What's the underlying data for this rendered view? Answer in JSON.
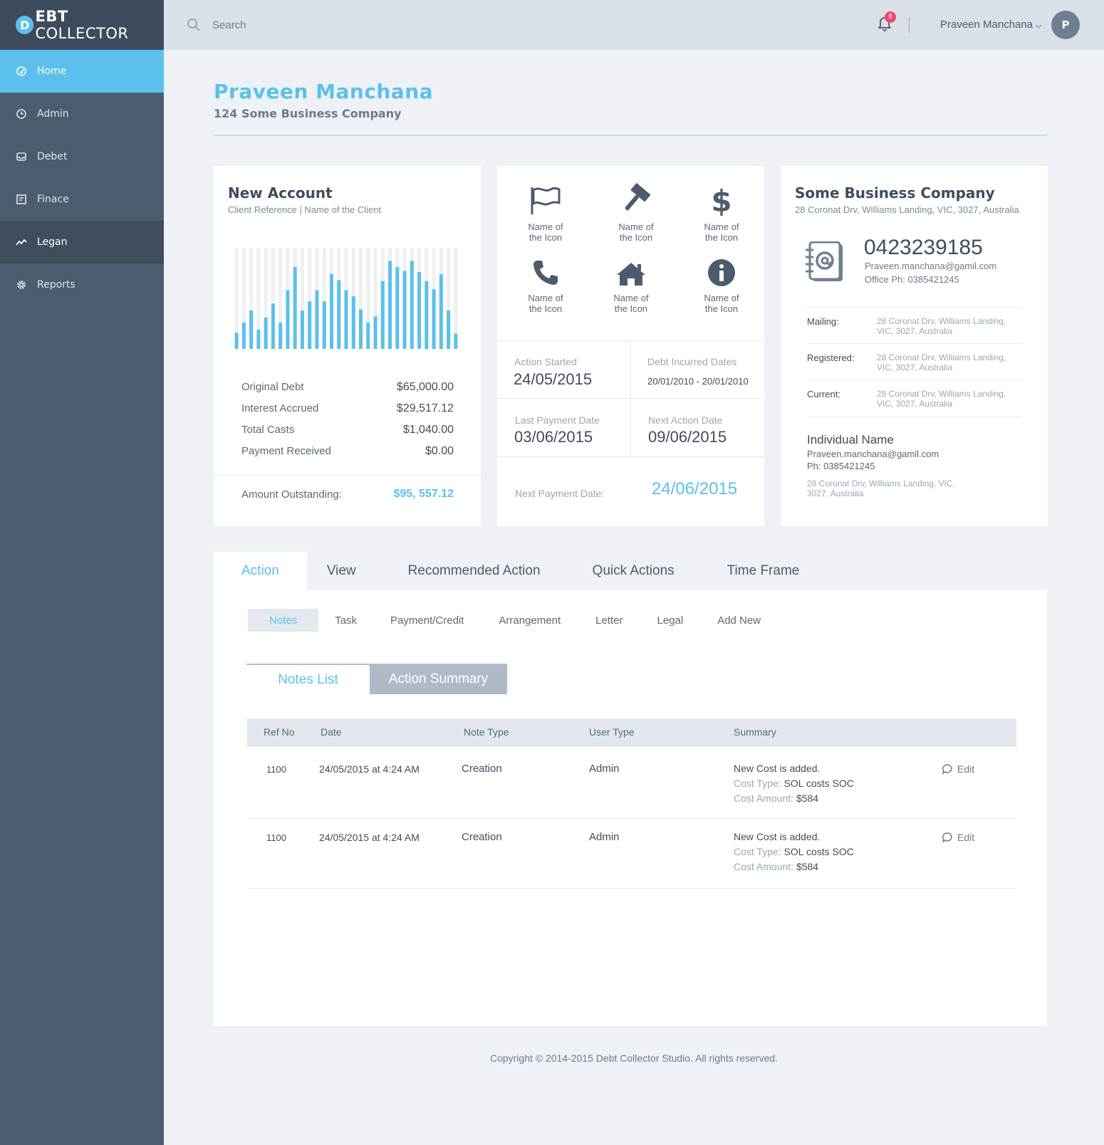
{
  "brand": {
    "first": "D",
    "bold": "EBT",
    "rest": " COLLECTOR"
  },
  "sidebar": {
    "items": [
      {
        "label": "Home",
        "icon": "home-icon"
      },
      {
        "label": "Admin",
        "icon": "clock-icon"
      },
      {
        "label": "Debet",
        "icon": "inbox-icon"
      },
      {
        "label": "Finace",
        "icon": "ledger-icon"
      },
      {
        "label": "Legan",
        "icon": "trend-icon"
      },
      {
        "label": "Reports",
        "icon": "gear-icon"
      }
    ]
  },
  "topbar": {
    "search_placeholder": "Search",
    "notification_count": "8",
    "user_name": "Praveen Manchana",
    "avatar_initial": "P"
  },
  "header": {
    "title": "Praveen Manchana",
    "subtitle": "124 Some Business Company"
  },
  "account": {
    "title": "New Account",
    "subtitle": "Client Reference  |  Name of the Client",
    "rows": [
      {
        "label": "Original Debt",
        "value": "$65,000.00"
      },
      {
        "label": "Interest Accrued",
        "value": "$29,517.12"
      },
      {
        "label": "Total Casts",
        "value": "$1,040.00"
      },
      {
        "label": "Payment Received",
        "value": "$0.00"
      }
    ],
    "outstanding_label": "Amount Outstanding:",
    "outstanding_value": "$95, 557.12"
  },
  "chart_data": {
    "type": "bar",
    "ylim": [
      0,
      1
    ],
    "values": [
      0.16,
      0.26,
      0.38,
      0.19,
      0.31,
      0.45,
      0.26,
      0.58,
      0.81,
      0.38,
      0.47,
      0.58,
      0.47,
      0.74,
      0.68,
      0.58,
      0.52,
      0.39,
      0.26,
      0.32,
      0.67,
      0.87,
      0.81,
      0.77,
      0.87,
      0.76,
      0.67,
      0.59,
      0.74,
      0.38,
      0.15
    ],
    "background_color": "#eef0f2",
    "bar_color": "#5bc0eb"
  },
  "icons": [
    {
      "icon": "flag-icon",
      "label": "Name of\nthe Icon"
    },
    {
      "icon": "gavel-icon",
      "label": "Name of\nthe Icon"
    },
    {
      "icon": "dollar-icon",
      "label": "Name of\nthe Icon"
    },
    {
      "icon": "phone-icon",
      "label": "Name of\nthe Icon"
    },
    {
      "icon": "house-icon",
      "label": "Name of\nthe Icon"
    },
    {
      "icon": "info-icon",
      "label": "Name of\nthe Icon"
    }
  ],
  "dates": {
    "action_started_label": "Action Started",
    "action_started": "24/05/2015",
    "debt_incurred_label": "Debt Incurred Dates",
    "debt_incurred": "20/01/2010 - 20/01/2010",
    "last_payment_label": "Last Payment Date",
    "last_payment": "03/06/2015",
    "next_action_label": "Next Action Date",
    "next_action": "09/06/2015",
    "next_payment_label": "Next Payment Date:",
    "next_payment": "24/06/2015"
  },
  "company": {
    "name": "Some Business Company",
    "address": "28 Coronat Drv, Williams Landing, VIC, 3027, Australia",
    "phone": "0423239185",
    "email": "Praveen.manchana@gamil.com",
    "office": "Office Ph: 0385421245",
    "addresses": [
      {
        "key": "Mailing:",
        "value": "28 Coronat Drv, Williams Landing, VIC, 3027, Australia"
      },
      {
        "key": "Registered:",
        "value": "28 Coronat Drv, Williams Landing, VIC, 3027, Australia"
      },
      {
        "key": "Current:",
        "value": "28 Coronat Drv, Williams Landing, VIC, 3027, Australia"
      }
    ],
    "individual_name": "Individual Name",
    "individual_email": "Praveen.manchana@gamil.com",
    "individual_phone": "Ph: 0385421245",
    "individual_address": "28 Coronat Drv, Williams Landing, VIC, 3027, Australia"
  },
  "tabs": [
    "Action",
    "View",
    "Recommended Action",
    "Quick Actions",
    "Time Frame"
  ],
  "subtabs": [
    "Notes",
    "Task",
    "Payment/Credit",
    "Arrangement",
    "Letter",
    "Legal",
    "Add New"
  ],
  "toggles": [
    "Notes List",
    "Action Summary"
  ],
  "table": {
    "headers": [
      "Ref No",
      "Date",
      "Note Type",
      "User Type",
      "Summary"
    ],
    "rows": [
      {
        "ref": "1100",
        "date": "24/05/2015 at 4:24 AM",
        "note_type": "Creation",
        "user_type": "Admin",
        "summary": "New Cost is added.",
        "cost_type_label": "Cost Type:",
        "cost_type": "SOL costs SOC",
        "cost_amount_label": "Cost Amount:",
        "cost_amount": "$584",
        "edit": "Edit"
      },
      {
        "ref": "1100",
        "date": "24/05/2015 at 4:24 AM",
        "note_type": "Creation",
        "user_type": "Admin",
        "summary": "New Cost is added.",
        "cost_type_label": "Cost Type:",
        "cost_type": "SOL costs SOC",
        "cost_amount_label": "Cost Amount:",
        "cost_amount": "$584",
        "edit": "Edit"
      }
    ]
  },
  "footer": "Copyright © 2014-2015 Debt Collector Studio. All rights reserved.",
  "colors": {
    "accent": "#5bc0eb",
    "sidebar": "#4d5d70",
    "badge": "#f0466f"
  }
}
